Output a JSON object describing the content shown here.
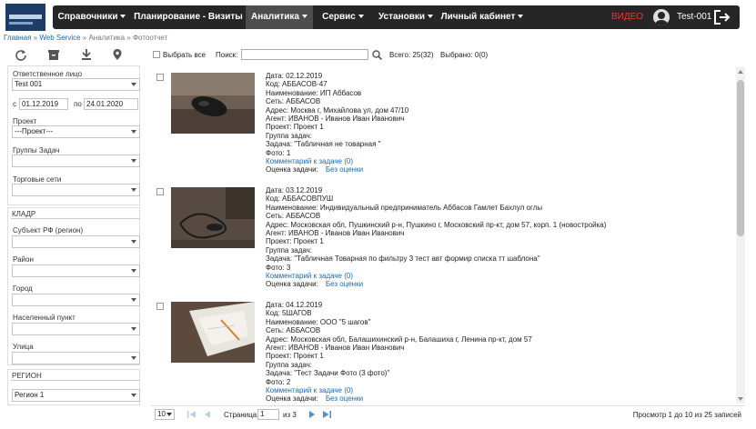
{
  "nav": {
    "items": [
      {
        "label": "Справочники"
      },
      {
        "label": "Планирование - Визиты"
      },
      {
        "label": "Аналитика"
      },
      {
        "label": "Сервис"
      },
      {
        "label": "Установки"
      },
      {
        "label": "Личный кабинет"
      }
    ],
    "video": "ВИДЕО",
    "user": "Test-001"
  },
  "breadcrumb": {
    "home": "Главная",
    "ws": "Web Service",
    "rest": " » Аналитика » Фотоотчет",
    "sep": " » "
  },
  "sidebar": {
    "responsible_label": "Ответственное лицо",
    "responsible_value": "Test 001",
    "from_label": "с",
    "from_date": "01.12.2019",
    "to_label": "по",
    "to_date": "24.01.2020",
    "project_label": "Проект",
    "project_value": "---Проект---",
    "task_groups_label": "Группы Задач",
    "trade_nets_label": "Торговые сети",
    "kladr_title": "КЛАДР",
    "subject_label": "Субъект РФ (регион)",
    "district_label": "Район",
    "city_label": "Город",
    "locality_label": "Населенный пункт",
    "street_label": "Улица",
    "region_title": "РЕГИОН",
    "region_value": "Регион 1"
  },
  "toolbar": {
    "select_all": "Выбрать все",
    "search_label": "Поиск:",
    "total": "Всего: 25(32)",
    "selected": "Выбрано: 0(0)"
  },
  "items": [
    {
      "date": "Дата: 02.12.2019",
      "code": "Код: АББАСОВ-47",
      "name": "Наименование: ИП Аббасов",
      "net": "Сеть: АББАСОВ",
      "address": "Адрес: Москва г, Михайлова ул, дом 47/10",
      "agent": "Агент: ИВАНОВ - Иванов Иван Иванович",
      "project": "Проект: Проект 1",
      "group": "Группа задач:",
      "task": "Задача: \"Табличная не товарная \"",
      "photo": "Фото: 1",
      "comment": "Комментарий к задаче (0)",
      "rating_label": "Оценка задачи:",
      "rating_value": "Без оценки"
    },
    {
      "date": "Дата: 03.12.2019",
      "code": "Код: АББАСОВПУШ",
      "name": "Наименование: Индивидуальный предприниматель Аббасов Гамлет Бахлул оглы",
      "net": "Сеть: АББАСОВ",
      "address": "Адрес: Московская обл, Пушкинский р-н, Пушкино г, Московский пр-кт, дом 57, корп. 1 (новостройка)",
      "agent": "Агент: ИВАНОВ - Иванов Иван Иванович",
      "project": "Проект: Проект 1",
      "group": "Группа задач:",
      "task": "Задача: \"Табличная Товарная по фильтру 3 тест авт формир списка тт шаблона\"",
      "photo": "Фото: 3",
      "comment": "Комментарий к задаче (0)",
      "rating_label": "Оценка задачи:",
      "rating_value": "Без оценки"
    },
    {
      "date": "Дата: 04.12.2019",
      "code": "Код: 5ШАГОВ",
      "name": "Наименование: ООО \"5 шагов\"",
      "net": "Сеть: АББАСОВ",
      "address": "Адрес: Московская обл, Балашихинский р-н, Балашиха г, Ленина пр-кт, дом 57",
      "agent": "Агент: ИВАНОВ - Иванов Иван Иванович",
      "project": "Проект: Проект 1",
      "group": "Группа задач:",
      "task": "Задача: \"Тест Задачи Фото (3 фото)\"",
      "photo": "Фото: 2",
      "comment": "Комментарий к задаче (0)",
      "rating_label": "Оценка задачи:",
      "rating_value": "Без оценки"
    }
  ],
  "pager": {
    "page_size": "10",
    "page_label": "Страница",
    "page": "1",
    "of": "из 3",
    "summary": "Просмотр 1 до 10 из 25 записей"
  }
}
